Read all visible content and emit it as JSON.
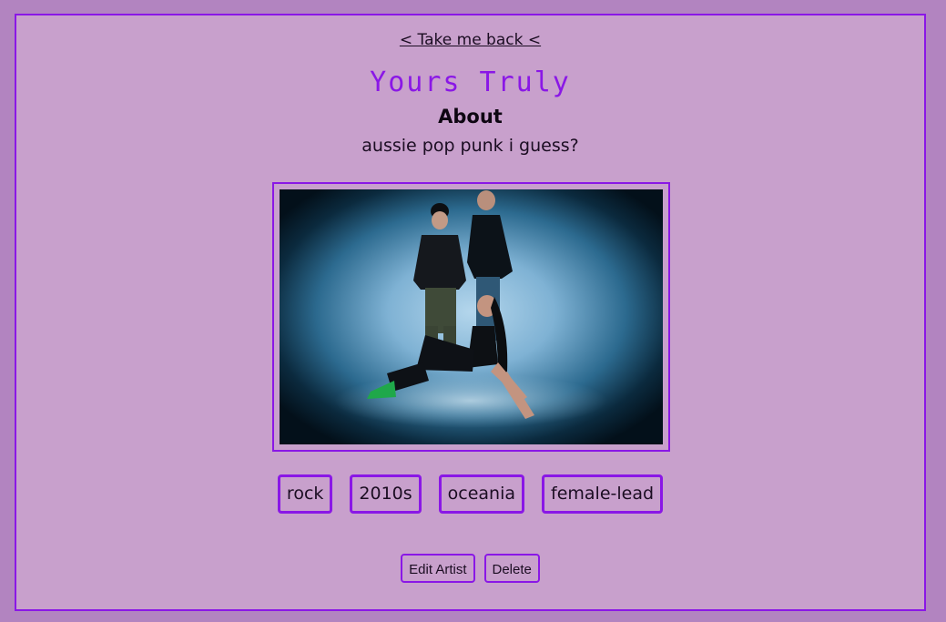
{
  "nav": {
    "back_label": "< Take me back <"
  },
  "artist": {
    "name": "Yours Truly",
    "about_heading": "About",
    "about_text": "aussie pop punk i guess?"
  },
  "photo": {
    "alt": "Yours Truly band photo"
  },
  "tags": [
    "rock",
    "2010s",
    "oceania",
    "female-lead"
  ],
  "actions": {
    "edit_label": "Edit Artist",
    "delete_label": "Delete"
  },
  "colors": {
    "accent": "#8a17e6",
    "page_background": "#b284c0",
    "panel_background": "#c8a0cc"
  }
}
